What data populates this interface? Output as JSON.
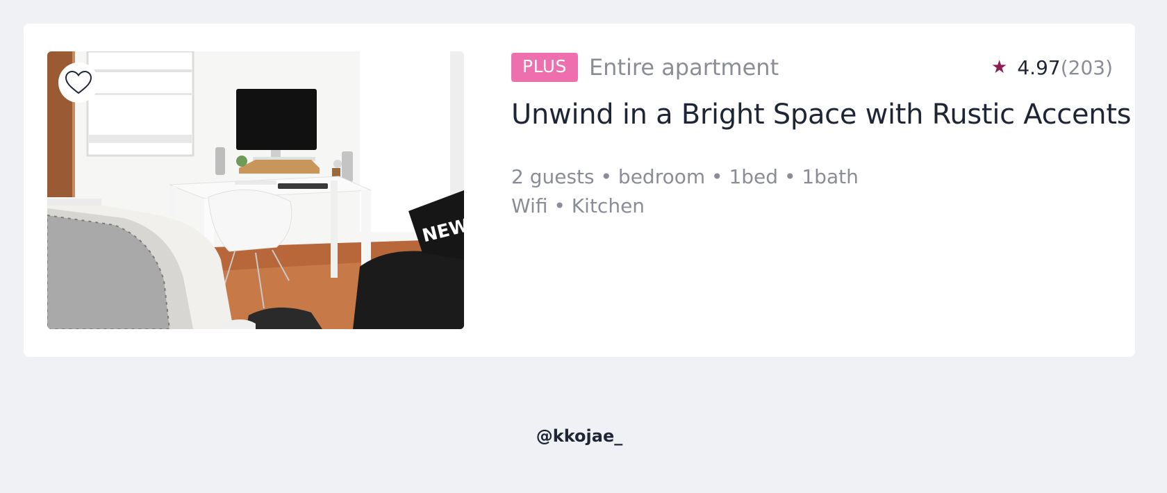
{
  "listing": {
    "badge": "PLUS",
    "property_type": "Entire apartment",
    "rating": {
      "icon": "star-icon",
      "score": "4.97",
      "count": "(203)",
      "star_color": "#8b1d52"
    },
    "title": "Unwind in a Bright Space with Rustic Accents",
    "details_line1": "2 guests • bedroom • 1bed • 1bath",
    "details_line2": "Wifi • Kitchen",
    "favorite_icon": "heart-icon",
    "badge_color": "#ed6fae"
  },
  "footer": {
    "handle": "@kkojae_"
  }
}
